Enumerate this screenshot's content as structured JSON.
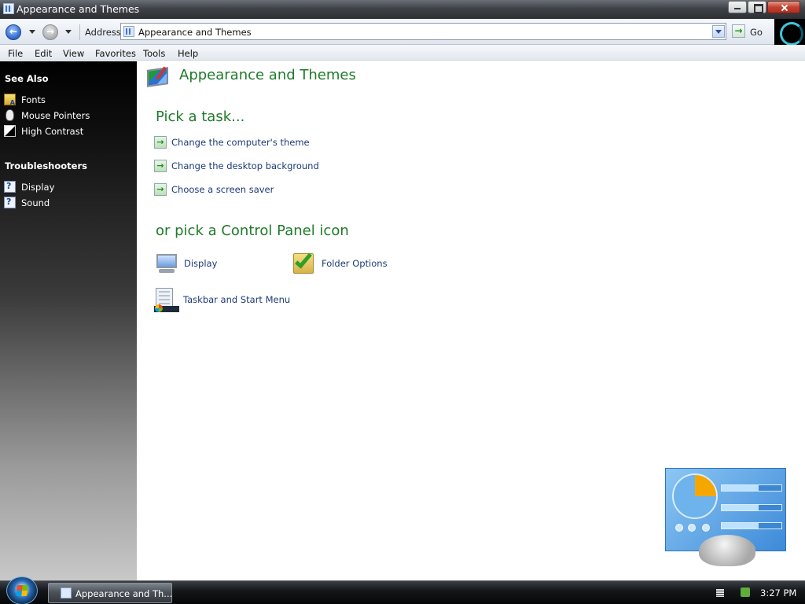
{
  "window": {
    "title": "Appearance and Themes"
  },
  "addressbar": {
    "label": "Address",
    "value": "Appearance and Themes",
    "go_label": "Go"
  },
  "menubar": {
    "items": [
      "File",
      "Edit",
      "View",
      "Favorites",
      "Tools",
      "Help"
    ]
  },
  "sidebar": {
    "see_also": {
      "title": "See Also",
      "items": [
        {
          "label": "Fonts",
          "icon": "fonts-folder-icon"
        },
        {
          "label": "Mouse Pointers",
          "icon": "mouse-icon"
        },
        {
          "label": "High Contrast",
          "icon": "high-contrast-icon"
        }
      ]
    },
    "troubleshooters": {
      "title": "Troubleshooters",
      "items": [
        {
          "label": "Display",
          "icon": "help-icon"
        },
        {
          "label": "Sound",
          "icon": "help-icon"
        }
      ]
    }
  },
  "main": {
    "title": "Appearance and Themes",
    "pick_task_heading": "Pick a task...",
    "tasks": [
      "Change the computer's theme",
      "Change the desktop background",
      "Choose a screen saver"
    ],
    "pick_icon_heading": "or pick a Control Panel icon",
    "icons": [
      {
        "label": "Display",
        "icon": "display-icon"
      },
      {
        "label": "Folder Options",
        "icon": "folder-options-icon"
      },
      {
        "label": "Taskbar and Start Menu",
        "icon": "taskbar-icon"
      }
    ]
  },
  "taskbar": {
    "window_button": "Appearance and Th...",
    "clock": "3:27 PM"
  },
  "colors": {
    "heading_green": "#1f7a2a",
    "link_blue": "#1c3a78",
    "sidebar_top": "#000000"
  }
}
